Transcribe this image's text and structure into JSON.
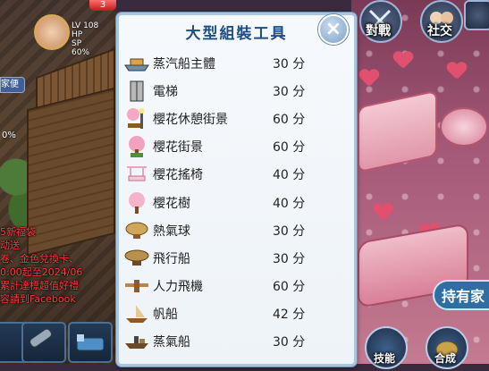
{
  "dialog": {
    "title": "大型組裝工具",
    "close_label": "×",
    "items": [
      {
        "name": "蒸汽船主體",
        "time": "30 分",
        "icon": "steamship-hull-icon"
      },
      {
        "name": "電梯",
        "time": "30 分",
        "icon": "elevator-icon"
      },
      {
        "name": "櫻花休憩街景",
        "time": "60 分",
        "icon": "sakura-streetlamp-icon"
      },
      {
        "name": "櫻花街景",
        "time": "60 分",
        "icon": "sakura-tree-pot-icon"
      },
      {
        "name": "櫻花搖椅",
        "time": "40 分",
        "icon": "sakura-swing-chair-icon"
      },
      {
        "name": "櫻花樹",
        "time": "40 分",
        "icon": "sakura-tree-icon"
      },
      {
        "name": "熱氣球",
        "time": "30 分",
        "icon": "hot-air-balloon-icon"
      },
      {
        "name": "飛行船",
        "time": "30 分",
        "icon": "airship-icon"
      },
      {
        "name": "人力飛機",
        "time": "60 分",
        "icon": "human-powered-plane-icon"
      },
      {
        "name": "帆船",
        "time": "42 分",
        "icon": "sailboat-icon"
      },
      {
        "name": "蒸氣船",
        "time": "30 分",
        "icon": "steamship-icon"
      }
    ]
  },
  "hud": {
    "lv_label": "LV",
    "lv_value": "108",
    "hp_label": "HP",
    "sp_label": "SP",
    "sp_percent": "60%",
    "tag": "家便",
    "badge_count": "3",
    "left_percent": "0%"
  },
  "top_buttons": {
    "battle_label": "對戰",
    "social_label": "社交"
  },
  "announcement_lines": [
    "5新福袋",
    "动送",
    "卷、金色兌換卡、",
    "0:00起至2024/06",
    "累計達標超值好禮",
    "容請到Facebook"
  ],
  "owned_label": "持有家",
  "bottom_buttons": {
    "skill_label": "技能",
    "compose_label": "合成"
  },
  "colors": {
    "title_blue": "#1d4f86",
    "panel_border": "#a9c6df",
    "announcement_red": "#ff3b3b"
  }
}
